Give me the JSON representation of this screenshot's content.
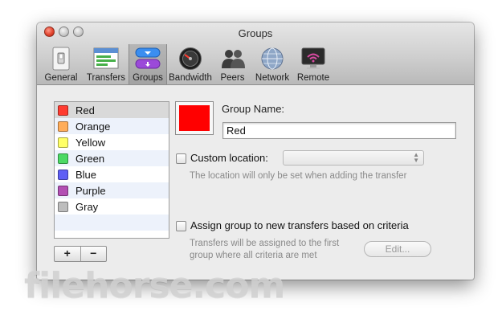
{
  "window": {
    "title": "Groups"
  },
  "tabs": [
    {
      "label": "General",
      "icon": "light-switch-icon"
    },
    {
      "label": "Transfers",
      "icon": "transfer-list-icon"
    },
    {
      "label": "Groups",
      "icon": "groups-pill-icon"
    },
    {
      "label": "Bandwidth",
      "icon": "speedometer-icon"
    },
    {
      "label": "Peers",
      "icon": "people-icon"
    },
    {
      "label": "Network",
      "icon": "globe-icon"
    },
    {
      "label": "Remote",
      "icon": "monitor-wifi-icon"
    }
  ],
  "active_tab": "Groups",
  "groups": [
    {
      "name": "Red",
      "color": "#ff3b30"
    },
    {
      "name": "Orange",
      "color": "#ffad5a"
    },
    {
      "name": "Yellow",
      "color": "#ffff66"
    },
    {
      "name": "Green",
      "color": "#4cd964"
    },
    {
      "name": "Blue",
      "color": "#5f5ff5"
    },
    {
      "name": "Purple",
      "color": "#b34fb3"
    },
    {
      "name": "Gray",
      "color": "#bdbdbd"
    }
  ],
  "selected_group": "Red",
  "list_buttons": {
    "add": "+",
    "remove": "−"
  },
  "detail": {
    "group_color": "#ff0000",
    "group_name_label": "Group Name:",
    "group_name_value": "Red",
    "custom_location_label": "Custom location:",
    "custom_location_value": "",
    "custom_location_hint": "The location will only be set when adding the transfer",
    "assign_label": "Assign group to new transfers based on criteria",
    "assign_hint_1": "Transfers will be assigned to the first",
    "assign_hint_2": "group where all criteria are met",
    "edit_button": "Edit..."
  },
  "watermark": "filehorse.com"
}
